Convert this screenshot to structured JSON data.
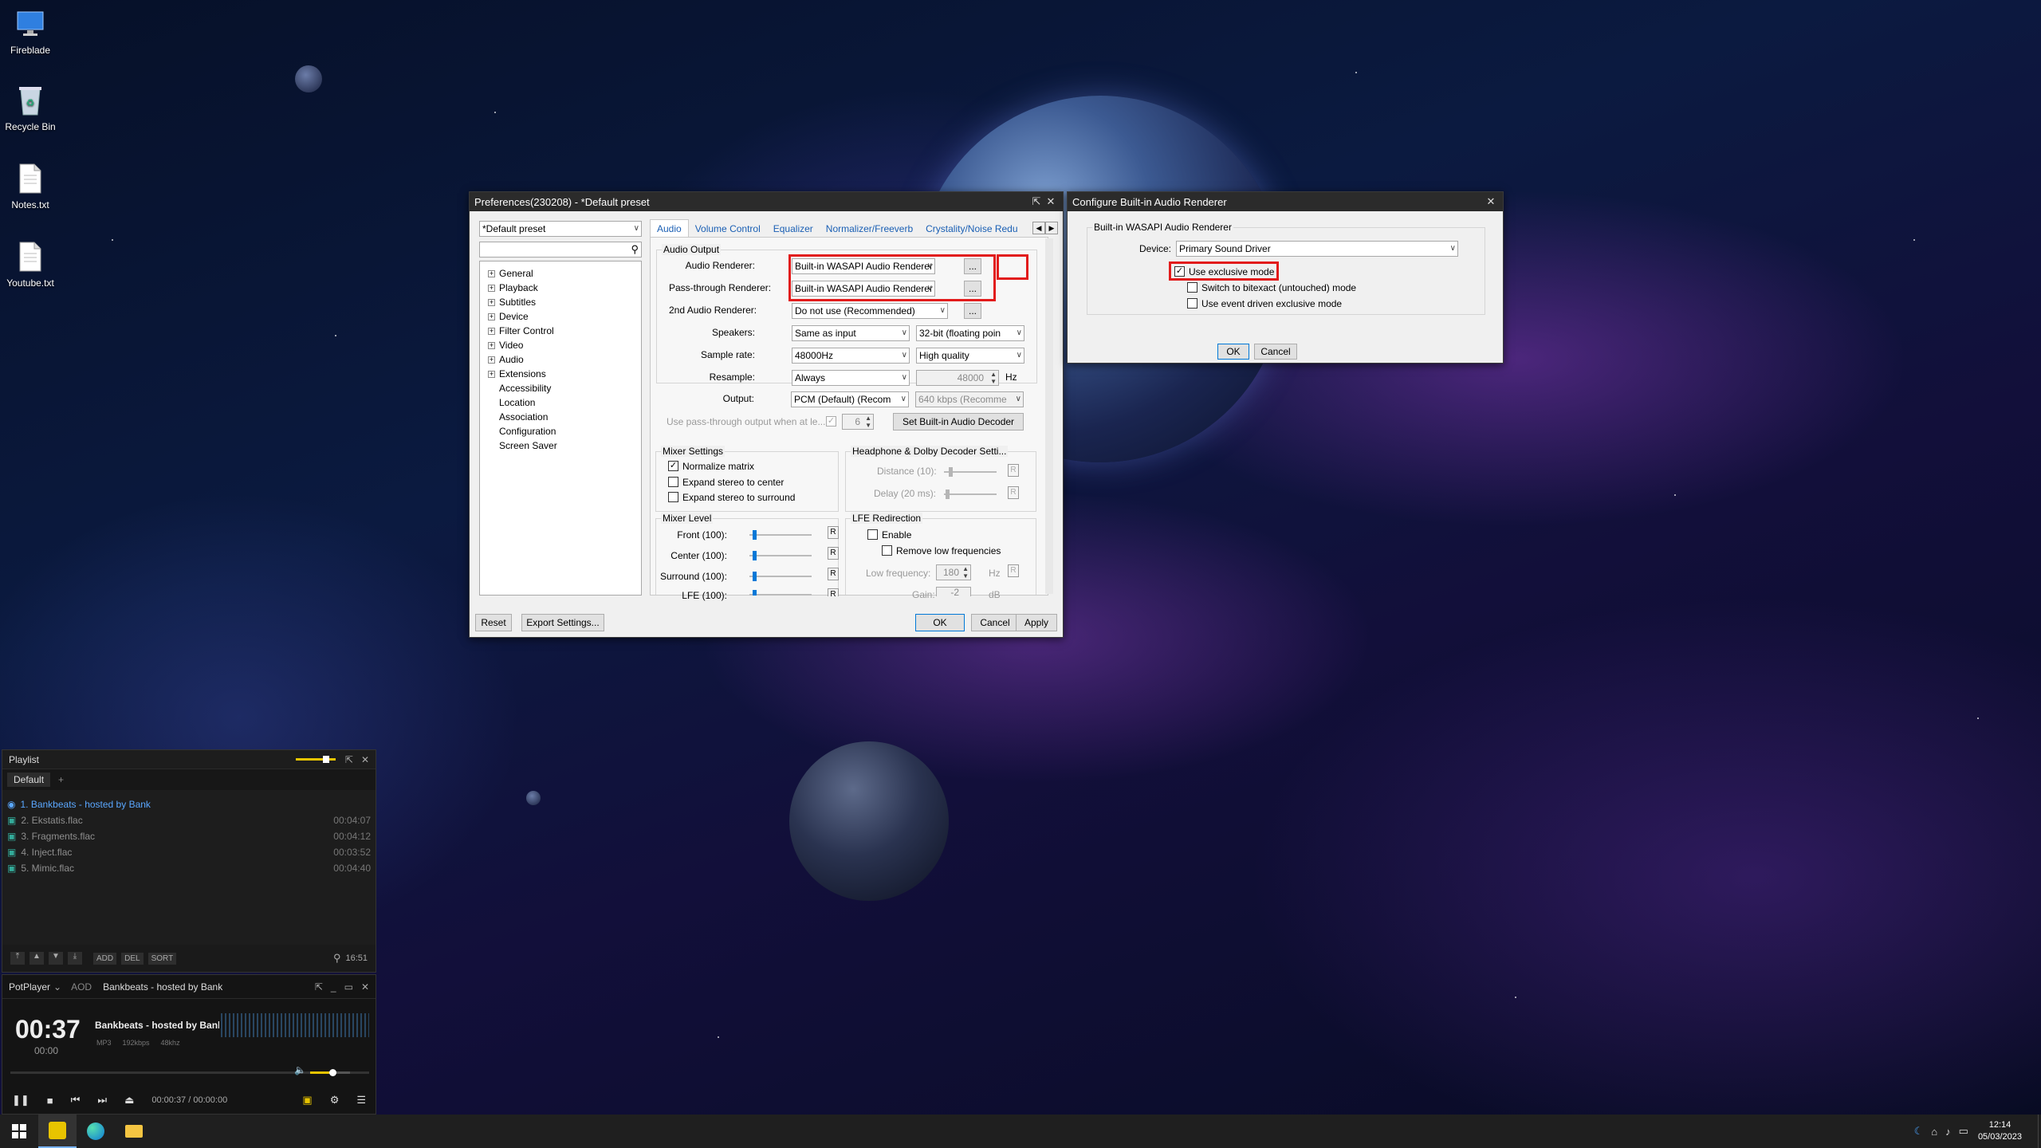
{
  "desktop": {
    "icons": [
      {
        "label": "Fireblade",
        "icon": "monitor-icon"
      },
      {
        "label": "Recycle Bin",
        "icon": "recycle-bin-icon"
      },
      {
        "label": "Notes.txt",
        "icon": "text-file-icon"
      },
      {
        "label": "Youtube.txt",
        "icon": "text-file-icon"
      }
    ]
  },
  "prefs": {
    "title": "Preferences(230208) - *Default preset",
    "preset": "*Default preset",
    "search_placeholder": "",
    "tree": [
      {
        "label": "General",
        "expandable": true
      },
      {
        "label": "Playback",
        "expandable": true
      },
      {
        "label": "Subtitles",
        "expandable": true
      },
      {
        "label": "Device",
        "expandable": true
      },
      {
        "label": "Filter Control",
        "expandable": true
      },
      {
        "label": "Video",
        "expandable": true
      },
      {
        "label": "Audio",
        "expandable": true
      },
      {
        "label": "Extensions",
        "expandable": true
      },
      {
        "label": "Accessibility",
        "expandable": false
      },
      {
        "label": "Location",
        "expandable": false
      },
      {
        "label": "Association",
        "expandable": false
      },
      {
        "label": "Configuration",
        "expandable": false
      },
      {
        "label": "Screen Saver",
        "expandable": false
      }
    ],
    "tabs": [
      "Audio",
      "Volume Control",
      "Equalizer",
      "Normalizer/Freeverb",
      "Crystality/Noise Redu"
    ],
    "audio_output": {
      "group": "Audio Output",
      "audio_renderer_label": "Audio Renderer:",
      "audio_renderer": "Built-in WASAPI Audio Renderer",
      "passthrough_label": "Pass-through Renderer:",
      "passthrough": "Built-in WASAPI Audio Renderer",
      "second_label": "2nd Audio Renderer:",
      "second": "Do not use (Recommended)",
      "speakers_label": "Speakers:",
      "speakers": "Same as input",
      "bits": "32-bit (floating poin",
      "sample_rate_label": "Sample rate:",
      "sample_rate": "48000Hz",
      "quality": "High quality",
      "resample_label": "Resample:",
      "resample": "Always",
      "resample_hz": "48000",
      "hz_unit": "Hz",
      "output_label": "Output:",
      "output": "PCM (Default) (Recom",
      "bitrate": "640 kbps (Recomme",
      "passthrough_when": "Use pass-through output when at le...",
      "passthrough_channels": "6",
      "set_decoder": "Set Built-in Audio Decoder",
      "dots": "..."
    },
    "mixer": {
      "group": "Mixer Settings",
      "normalize": "Normalize matrix",
      "normalize_checked": true,
      "expand_center": "Expand stereo to center",
      "expand_surround": "Expand stereo to surround"
    },
    "headphone": {
      "group": "Headphone & Dolby Decoder Setti...",
      "distance": "Distance (10):",
      "delay": "Delay (20 ms):"
    },
    "mixer_level": {
      "group": "Mixer Level",
      "front": "Front (100):",
      "center": "Center (100):",
      "surround": "Surround (100):",
      "lfe": "LFE (100):",
      "r": "R"
    },
    "lfe": {
      "group": "LFE Redirection",
      "enable": "Enable",
      "remove_low": "Remove low frequencies",
      "low_freq": "Low frequency:",
      "low_freq_val": "180",
      "low_unit": "Hz",
      "gain": "Gain:",
      "gain_val": "-2",
      "gain_unit": "dB"
    },
    "buttons": {
      "reset": "Reset",
      "export": "Export Settings...",
      "ok": "OK",
      "cancel": "Cancel",
      "apply": "Apply"
    }
  },
  "configure": {
    "title": "Configure Built-in Audio Renderer",
    "group": "Built-in WASAPI Audio Renderer",
    "device_label": "Device:",
    "device": "Primary Sound Driver",
    "exclusive": "Use exclusive mode",
    "exclusive_checked": true,
    "bitexact": "Switch to bitexact (untouched) mode",
    "event_driven": "Use event driven exclusive mode",
    "ok": "OK",
    "cancel": "Cancel"
  },
  "playlist": {
    "title": "Playlist",
    "tab": "Default",
    "add_tab": "+",
    "items": [
      {
        "name": "1. Bankbeats - hosted by Bank",
        "duration": "",
        "current": true
      },
      {
        "name": "2. Ekstatis.flac",
        "duration": "00:04:07",
        "current": false
      },
      {
        "name": "3. Fragments.flac",
        "duration": "00:04:12",
        "current": false
      },
      {
        "name": "4. Inject.flac",
        "duration": "00:03:52",
        "current": false
      },
      {
        "name": "5. Mimic.flac",
        "duration": "00:04:40",
        "current": false
      }
    ],
    "buttons": [
      "ADD",
      "DEL",
      "SORT"
    ],
    "total": "16:51"
  },
  "player": {
    "menu": "PotPlayer",
    "aod": "AOD",
    "track_title": "Bankbeats - hosted by Bank",
    "time_big": "00:37",
    "time_small": "00:00",
    "track_name": "Bankbeats - hosted by Banl",
    "format": "MP3",
    "bitrate": "192kbps",
    "samplerate": "48khz",
    "position": "00:00:37",
    "separator": "/",
    "duration": "00:00:00",
    "volume": 0.55
  },
  "taskbar": {
    "time": "12:14",
    "date": "05/03/2023"
  }
}
